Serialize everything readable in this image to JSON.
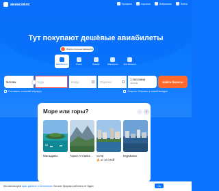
{
  "header": {
    "logo_text": "авиасейлс",
    "nav": [
      {
        "label": "Профиль"
      },
      {
        "label": "Корзина"
      },
      {
        "label": "Избранное"
      },
      {
        "label": "Войти"
      }
    ]
  },
  "hero": {
    "title": "Тут покупают дешёвые авиабилеты",
    "hotel_tip": "Ищите отель на Авиасейлс"
  },
  "tabs": [
    {
      "label": "Авиабилеты",
      "active": true,
      "icon": "plane-icon"
    },
    {
      "label": "Отели",
      "active": false,
      "icon": "bed-icon"
    },
    {
      "label": "Поезда",
      "active": false,
      "icon": "train-icon"
    },
    {
      "label": "Маршруты",
      "active": false,
      "icon": "route-icon"
    },
    {
      "label": "Для бизнеса",
      "active": false,
      "icon": "briefcase-icon"
    }
  ],
  "search": {
    "from_value": "Москва",
    "to_placeholder": "Куда",
    "date_there_placeholder": "Когда",
    "date_back_placeholder": "Обратно",
    "passengers_value": "1 пассажир",
    "class_value": "эконом",
    "search_button": "Найти билеты",
    "compose_route": "Составить сложный маршрут",
    "open_booking": "Открыть Островок в новой вкладке"
  },
  "promo": {
    "title": "Море или горы?",
    "destinations": [
      {
        "name": "Мальдивы",
        "price": ""
      },
      {
        "name": "Горнo-Алтайск",
        "price": ""
      },
      {
        "name": "Сочи",
        "price": "от 10 174₽"
      },
      {
        "name": "Мурманск",
        "price": ""
      }
    ]
  },
  "cookie_bar": {
    "text": "Мы используем",
    "link": "куки, данные и технологии",
    "text2": ". Без них браузер работать не будет.",
    "ok": "Ок"
  },
  "colors": {
    "primary": "#0c73fe",
    "accent": "#ff6a2c",
    "error_border": "#ff4d4d"
  }
}
